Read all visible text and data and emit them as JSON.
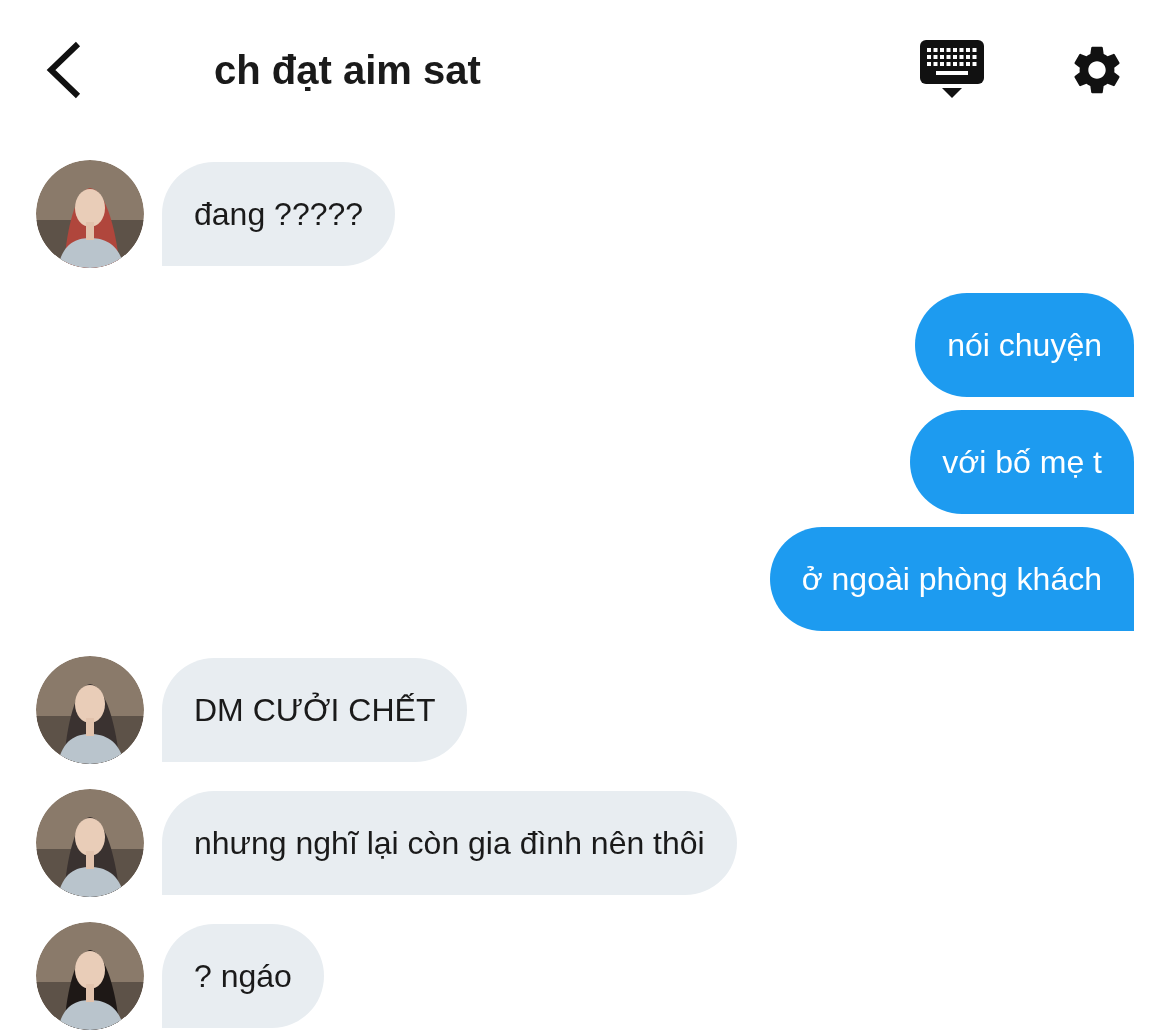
{
  "header": {
    "title": "ch đạt aim sat"
  },
  "messages": [
    {
      "kind": "incoming",
      "text": "đang ?????"
    },
    {
      "kind": "outgoing",
      "text": "nói chuyện"
    },
    {
      "kind": "outgoing",
      "text": "với bố mẹ t"
    },
    {
      "kind": "outgoing",
      "text": "ở ngoài phòng khách"
    },
    {
      "kind": "incoming",
      "text": "DM CƯỞI CHẾT"
    },
    {
      "kind": "incoming",
      "text": "nhưng nghĩ lại còn gia đình nên thôi"
    },
    {
      "kind": "incoming",
      "text": "? ngáo"
    }
  ]
}
